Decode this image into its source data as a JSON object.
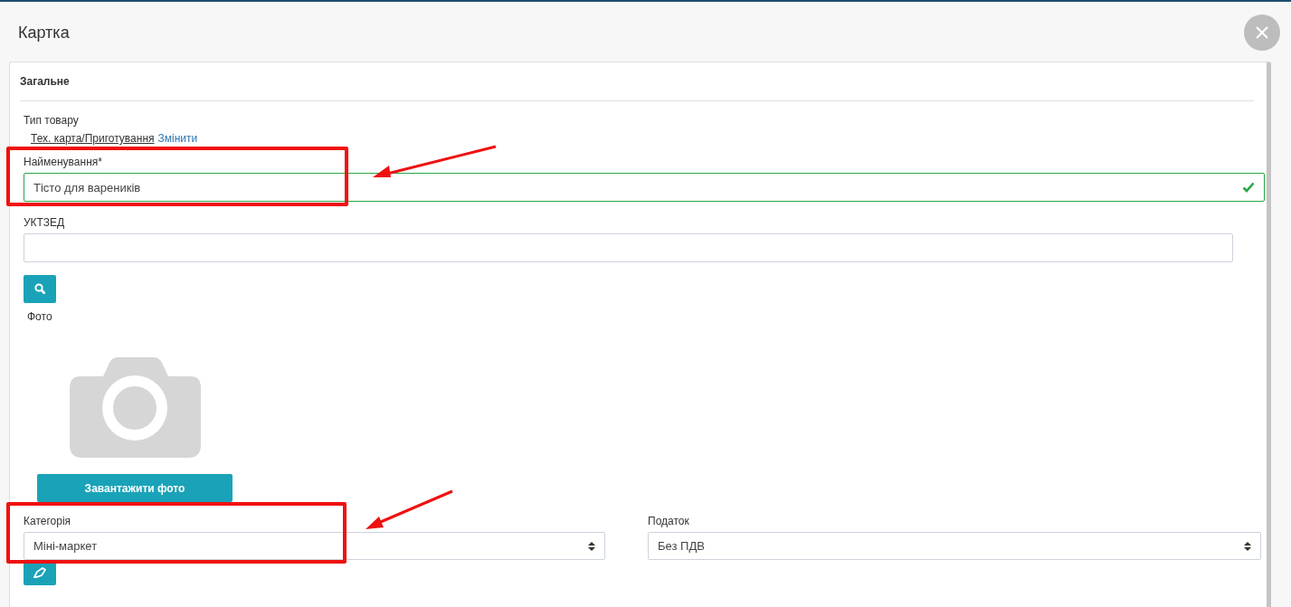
{
  "window": {
    "title": "Картка"
  },
  "section": {
    "title": "Загальне"
  },
  "product_type": {
    "label": "Тип товару",
    "value": "Тех. карта/Приготування",
    "change_link": "Змінити"
  },
  "name_field": {
    "label": "Найменування*",
    "value": "Тісто для вареників",
    "valid": true,
    "highlighted": true
  },
  "uktzed_field": {
    "label": "УКТЗЕД"
  },
  "photo": {
    "label": "Фото",
    "upload_button": "Завантажити фото"
  },
  "selects": [
    {
      "label": "Категорія",
      "value": "Міні-маркет",
      "highlighted": true
    },
    {
      "label": "Податок",
      "value": "Без ПДВ",
      "highlighted": false
    }
  ]
}
